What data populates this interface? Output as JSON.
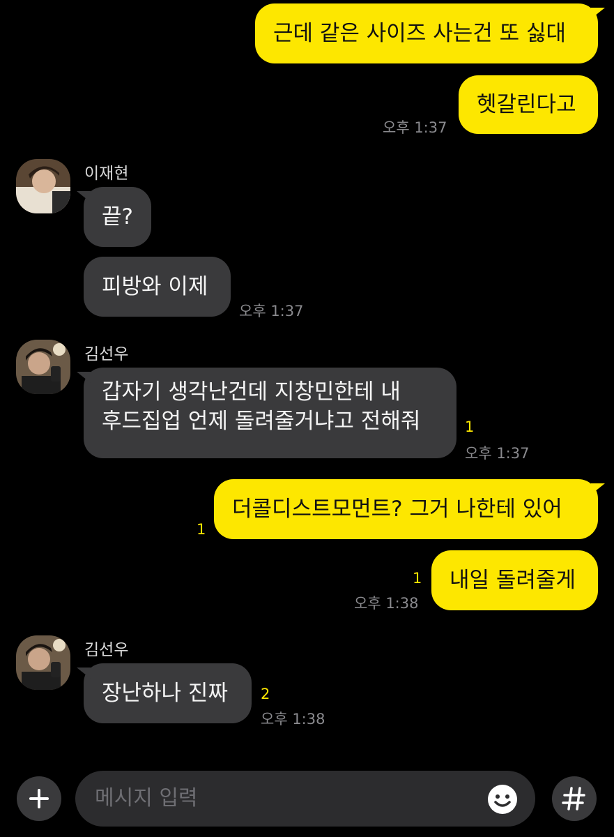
{
  "messages": {
    "m1": "근데 같은 사이즈 사는건 또 싫대",
    "m2": "헷갈린다고",
    "m2_time": "오후 1:37",
    "sender1": "이재현",
    "m3": "끝?",
    "m4": "피방와 이제",
    "m4_time": "오후 1:37",
    "sender2": "김선우",
    "m5_line1": "갑자기 생각난건데 지창민한테 내",
    "m5_line2": "후드집업 언제 돌려줄거냐고 전해줘",
    "m5_unread": "1",
    "m5_time": "오후 1:37",
    "m6": "더콜디스트모먼트? 그거 나한테 있어",
    "m6_unread": "1",
    "m7": "내일 돌려줄게",
    "m7_unread": "1",
    "m7_time": "오후 1:38",
    "sender3": "김선우",
    "m8": "장난하나 진짜",
    "m8_unread": "2",
    "m8_time": "오후 1:38"
  },
  "input": {
    "placeholder": "메시지 입력"
  },
  "icons": {
    "add": "plus-icon",
    "emoji": "emoji-icon",
    "hashtag": "hashtag-icon"
  },
  "colors": {
    "my_bubble": "#fde700",
    "their_bubble": "#3a3a3c",
    "background": "#000000"
  }
}
